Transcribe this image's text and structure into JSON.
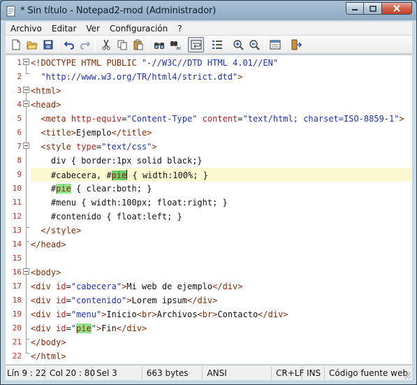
{
  "window": {
    "title": "* Sin título - Notepad2-mod (Administrador)"
  },
  "menu": [
    "Archivo",
    "Editar",
    "Ver",
    "Configuración",
    "?"
  ],
  "toolbar": {
    "buttons": [
      "new-file",
      "open-file",
      "save-file",
      "undo",
      "redo",
      "cut",
      "copy",
      "paste",
      "find",
      "replace",
      "word-wrap",
      "line-numbers",
      "zoom-in",
      "zoom-out",
      "settings",
      "exit"
    ]
  },
  "editor": {
    "current_line": 9,
    "lines": [
      {
        "n": "1",
        "tokens": [
          [
            "tag",
            "<!DOCTYPE HTML PUBLIC "
          ],
          [
            "str",
            "\"-//W3C//DTD HTML 4.01//EN\""
          ]
        ]
      },
      {
        "n": "2",
        "tokens": [
          [
            "pl",
            "  "
          ],
          [
            "str",
            "\"http://www.w3.org/TR/html4/strict.dtd\""
          ],
          [
            "tag",
            ">"
          ]
        ]
      },
      {
        "n": "3",
        "tokens": [
          [
            "tag",
            "<html>"
          ]
        ]
      },
      {
        "n": "4",
        "tokens": [
          [
            "tag",
            "<head>"
          ]
        ]
      },
      {
        "n": "5",
        "tokens": [
          [
            "pl",
            "  "
          ],
          [
            "tag",
            "<meta "
          ],
          [
            "attr",
            "http-equiv"
          ],
          [
            "pl",
            "="
          ],
          [
            "str",
            "\"Content-Type\""
          ],
          [
            "pl",
            " "
          ],
          [
            "attr",
            "content"
          ],
          [
            "pl",
            "="
          ],
          [
            "str",
            "\"text/html; charset=ISO-8859-1\""
          ],
          [
            "tag",
            ">"
          ]
        ]
      },
      {
        "n": "6",
        "tokens": [
          [
            "pl",
            "  "
          ],
          [
            "tag",
            "<title>"
          ],
          [
            "pl",
            "Ejemplo"
          ],
          [
            "tag",
            "</title>"
          ]
        ]
      },
      {
        "n": "7",
        "tokens": [
          [
            "pl",
            "  "
          ],
          [
            "tag",
            "<style "
          ],
          [
            "attr",
            "type"
          ],
          [
            "pl",
            "="
          ],
          [
            "str",
            "\"text/css\""
          ],
          [
            "tag",
            ">"
          ]
        ]
      },
      {
        "n": "8",
        "tokens": [
          [
            "pl",
            "    div { border:1px solid black;}"
          ]
        ]
      },
      {
        "n": "9",
        "tokens": [
          [
            "pl",
            "    #cabecera, #"
          ],
          [
            "hl-dark",
            "pie"
          ],
          [
            "caret",
            ""
          ],
          [
            "pl",
            " { width:100%; }"
          ]
        ]
      },
      {
        "n": "10",
        "tokens": [
          [
            "pl",
            "    #"
          ],
          [
            "hl",
            "pie"
          ],
          [
            "pl",
            " { clear:both; }"
          ]
        ]
      },
      {
        "n": "11",
        "tokens": [
          [
            "pl",
            "    #menu { width:100px; float:right; }"
          ]
        ]
      },
      {
        "n": "12",
        "tokens": [
          [
            "pl",
            "    #contenido { float:left; }"
          ]
        ]
      },
      {
        "n": "13",
        "tokens": [
          [
            "pl",
            "  "
          ],
          [
            "tag",
            "</style>"
          ]
        ]
      },
      {
        "n": "14",
        "tokens": [
          [
            "tag",
            "</head>"
          ]
        ]
      },
      {
        "n": "15",
        "tokens": []
      },
      {
        "n": "16",
        "tokens": [
          [
            "tag",
            "<body>"
          ]
        ]
      },
      {
        "n": "17",
        "tokens": [
          [
            "tag",
            "<div "
          ],
          [
            "attr",
            "id"
          ],
          [
            "pl",
            "="
          ],
          [
            "str",
            "\"cabecera\""
          ],
          [
            "tag",
            ">"
          ],
          [
            "pl",
            "Mi web de ejemplo"
          ],
          [
            "tag",
            "</div>"
          ]
        ]
      },
      {
        "n": "18",
        "tokens": [
          [
            "tag",
            "<div "
          ],
          [
            "attr",
            "id"
          ],
          [
            "pl",
            "="
          ],
          [
            "str",
            "\"contenido\""
          ],
          [
            "tag",
            ">"
          ],
          [
            "pl",
            "Lorem ipsum"
          ],
          [
            "tag",
            "</div>"
          ]
        ]
      },
      {
        "n": "19",
        "tokens": [
          [
            "tag",
            "<div "
          ],
          [
            "attr",
            "id"
          ],
          [
            "pl",
            "="
          ],
          [
            "str",
            "\"menu\""
          ],
          [
            "tag",
            ">"
          ],
          [
            "pl",
            "Inicio"
          ],
          [
            "tag",
            "<br>"
          ],
          [
            "pl",
            "Archivos"
          ],
          [
            "tag",
            "<br>"
          ],
          [
            "pl",
            "Contacto"
          ],
          [
            "tag",
            "</div>"
          ]
        ]
      },
      {
        "n": "20",
        "tokens": [
          [
            "tag",
            "<div "
          ],
          [
            "attr",
            "id"
          ],
          [
            "pl",
            "="
          ],
          [
            "str",
            "\""
          ],
          [
            "hl",
            "pie"
          ],
          [
            "str",
            "\""
          ],
          [
            "tag",
            ">"
          ],
          [
            "pl",
            "Fin"
          ],
          [
            "tag",
            "</div>"
          ]
        ]
      },
      {
        "n": "21",
        "tokens": [
          [
            "tag",
            "</body>"
          ]
        ]
      },
      {
        "n": "22",
        "tokens": [
          [
            "tag",
            "</html>"
          ]
        ]
      }
    ]
  },
  "status": {
    "position": "Lín 9 : 22",
    "column": "Col 20 : 80",
    "selection": "Sel 3",
    "size": "663 bytes",
    "encoding": "ANSI",
    "line_endings": "CR+LF",
    "insert_mode": "INS",
    "scheme": "Código fuente web"
  }
}
